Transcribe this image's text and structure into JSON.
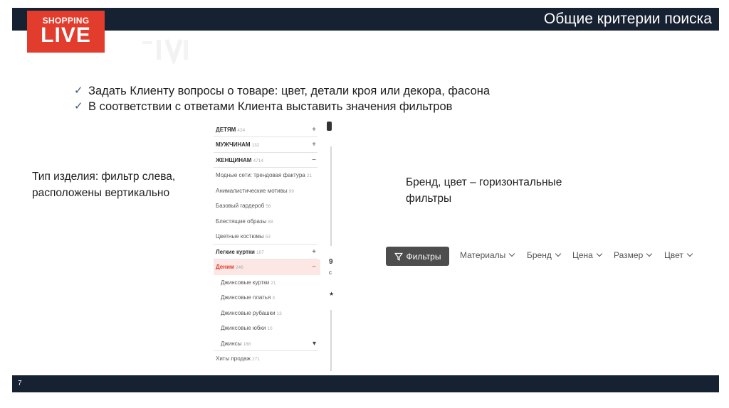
{
  "header": {
    "title": "Общие критерии поиска"
  },
  "logo": {
    "line1": "SHOPPING",
    "line2": "LIVE",
    "color": "#e23c2d"
  },
  "bullets": [
    "Задать Клиенту вопросы о товаре: цвет, детали кроя или декора, фасона",
    "В соответствии с ответами Клиента выставить значения фильтров"
  ],
  "left_caption": [
    "Тип изделия: фильтр слева,",
    "расположены вертикально"
  ],
  "right_caption": [
    "Бренд, цвет – горизонтальные",
    "фильтры"
  ],
  "category_menu": [
    {
      "label": "ДЕТЯМ",
      "count": "424",
      "sign": "+",
      "style": "bold"
    },
    {
      "label": "МУЖЧИНАМ",
      "count": "132",
      "sign": "+",
      "style": "bold"
    },
    {
      "label": "ЖЕНЩИНАМ",
      "count": "4714",
      "sign": "−",
      "style": "bold"
    },
    {
      "label": "Модные сети: трендовая фактура",
      "count": "21",
      "sign": "",
      "style": ""
    },
    {
      "label": "Анималистические мотивы",
      "count": "99",
      "sign": "",
      "style": ""
    },
    {
      "label": "Базовый гардероб",
      "count": "56",
      "sign": "",
      "style": ""
    },
    {
      "label": "Блестящие образы",
      "count": "88",
      "sign": "",
      "style": ""
    },
    {
      "label": "Цветные костюмы",
      "count": "53",
      "sign": "",
      "style": ""
    },
    {
      "label": "Легкие куртки",
      "count": "107",
      "sign": "+",
      "style": "bold"
    },
    {
      "label": "Деним",
      "count": "246",
      "sign": "−",
      "style": "active"
    },
    {
      "label": "Джинсовые куртки",
      "count": "21",
      "sign": "",
      "style": "sub"
    },
    {
      "label": "Джинсовые платья",
      "count": "3",
      "sign": "",
      "style": "sub"
    },
    {
      "label": "Джинсовые рубашки",
      "count": "13",
      "sign": "",
      "style": "sub"
    },
    {
      "label": "Джинсовые юбки",
      "count": "10",
      "sign": "",
      "style": "sub"
    },
    {
      "label": "Джинсы",
      "count": "188",
      "sign": "▾",
      "style": "sub"
    },
    {
      "label": "Хиты продаж",
      "count": "271",
      "sign": "",
      "style": ""
    }
  ],
  "fragments": [
    "9",
    "с",
    "★"
  ],
  "filters": {
    "button_label": "Фильтры",
    "items": [
      "Материалы",
      "Бренд",
      "Цена",
      "Размер",
      "Цвет"
    ]
  },
  "footer": {
    "page": "7"
  }
}
